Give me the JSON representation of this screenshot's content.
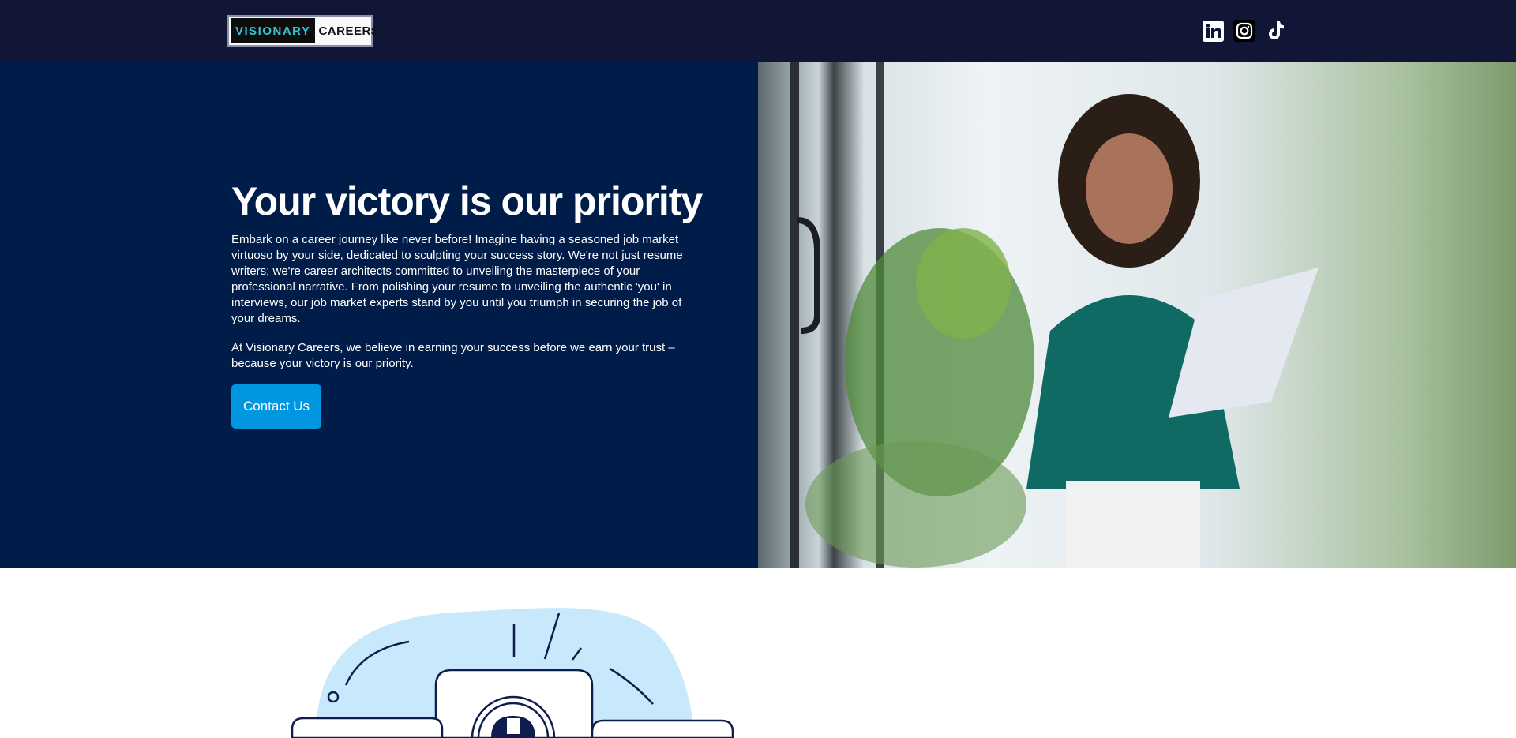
{
  "header": {
    "logo": {
      "part1": "VISIONARY",
      "part2": "CAREERS"
    },
    "socials": [
      {
        "name": "linkedin-icon"
      },
      {
        "name": "instagram-icon"
      },
      {
        "name": "tiktok-icon"
      }
    ]
  },
  "hero": {
    "title": "Your victory is our priority",
    "paragraph1": "Embark on a career journey like never before! Imagine having a seasoned job market virtuoso by your side, dedicated to sculpting your success story. We're not just resume writers; we're career architects committed to unveiling the masterpiece of your professional narrative. From polishing your resume to unveiling the authentic 'you' in interviews, our job market experts stand by you until you triumph in securing the job of your dreams.",
    "paragraph2": "At Visionary Careers, we believe in earning your success before we earn your trust – because your victory is our priority.",
    "cta": "Contact Us"
  },
  "colors": {
    "header": "#111536",
    "hero": "#001d4a",
    "accent": "#0096e0",
    "blob": "#c8e9fb"
  }
}
